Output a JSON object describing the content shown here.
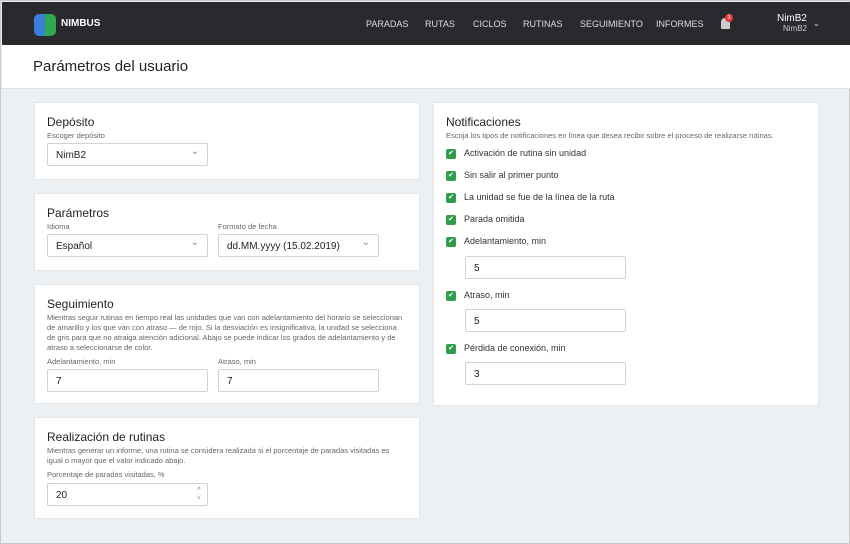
{
  "header": {
    "brand": "NIMBUS",
    "nav": [
      "PARADAS",
      "RUTAS",
      "CICLOS",
      "RUTINAS",
      "SEGUIMIENTO",
      "INFORMES"
    ],
    "notifications_count": "3",
    "user_name": "NimB2",
    "user_sub": "NimB2"
  },
  "page_title": "Parámetros del usuario",
  "deposito": {
    "title": "Depósito",
    "label": "Escoger depósito",
    "value": "NimB2"
  },
  "parametros": {
    "title": "Parámetros",
    "idioma_label": "Idioma",
    "idioma_value": "Español",
    "fecha_label": "Formato de fecha",
    "fecha_value": "dd.MM.yyyy (15.02.2019)"
  },
  "seguimiento": {
    "title": "Seguimiento",
    "description": "Mientras seguir rutinas en tiempo real las unidades que van con adelantamiento del horario se seleccionan de amarillo y los que van con atraso — de rojo. Si la desviación es insignificativa, la unidad se selecciona de gris para que no atraiga atención adicional. Abajo se puede indicar los grados de adelantamiento y de atraso a seleccionarse de color.",
    "adelanto_label": "Adelantamiento, min",
    "adelanto_value": "7",
    "atraso_label": "Atraso, min",
    "atraso_value": "7"
  },
  "realizacion": {
    "title": "Realización de rutinas",
    "description": "Mientras generar un informe, una rutina se considera realizada si el porcentaje de paradas visitadas es igual o mayor que el valor indicado abajo.",
    "label": "Porcentaje de paradas visitadas, %",
    "value": "20"
  },
  "notificaciones": {
    "title": "Notificaciones",
    "description": "Escoja los tipos de notificaciones en línea que desea recibir sobre el proceso de realizarse rutinas.",
    "items": [
      "Activación de rutina sin unidad",
      "Sin salir al primer punto",
      "La unidad se fue de la línea de la ruta",
      "Parada omitida",
      "Adelantamiento, min",
      "Atraso, min",
      "Pérdida de conexión, min"
    ],
    "adelanto_value": "5",
    "atraso_value": "5",
    "perdida_value": "3"
  }
}
